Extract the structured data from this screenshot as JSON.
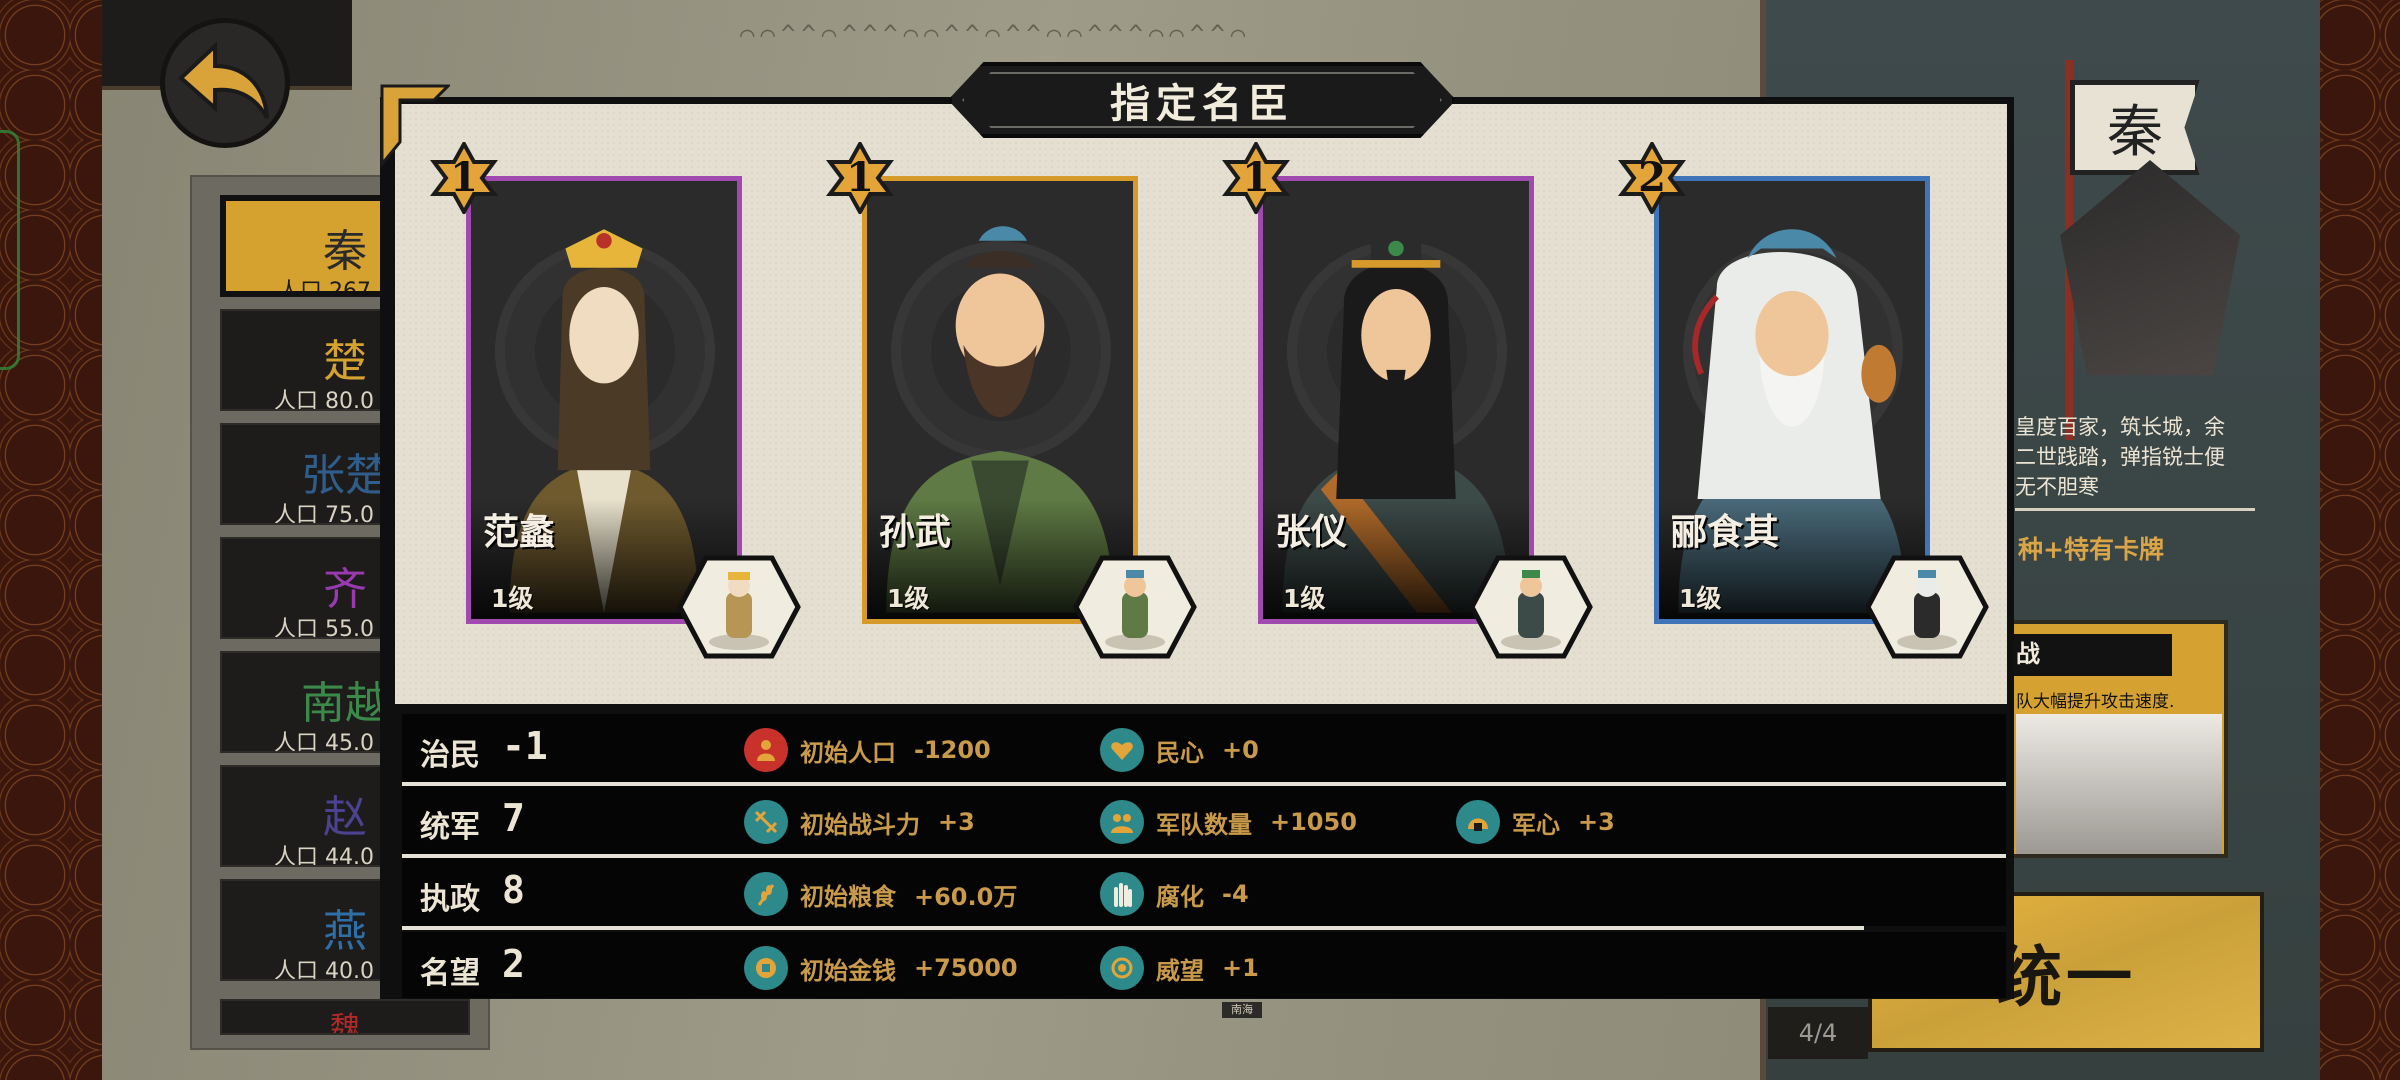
{
  "modal": {
    "title": "指定名臣"
  },
  "generals": [
    {
      "rank": "1",
      "name": "范蠡",
      "level": "1级",
      "frame_color": "#a04ab0"
    },
    {
      "rank": "1",
      "name": "孙武",
      "level": "1级",
      "frame_color": "#d69a2a"
    },
    {
      "rank": "1",
      "name": "张仪",
      "level": "1级",
      "frame_color": "#a04ab0"
    },
    {
      "rank": "2",
      "name": "郦食其",
      "level": "1级",
      "frame_color": "#3f74b8"
    }
  ],
  "stats": [
    {
      "name": "治民",
      "value": "-1",
      "effects": [
        {
          "label": "初始人口",
          "value": "-1200",
          "icon": "population-icon"
        },
        {
          "label": "民心",
          "value": "+0",
          "icon": "heart-icon"
        }
      ]
    },
    {
      "name": "统军",
      "value": "7",
      "effects": [
        {
          "label": "初始战斗力",
          "value": "+3",
          "icon": "crossbow-icon"
        },
        {
          "label": "军队数量",
          "value": "+1050",
          "icon": "troops-icon"
        },
        {
          "label": "军心",
          "value": "+3",
          "icon": "helmet-icon"
        }
      ]
    },
    {
      "name": "执政",
      "value": "8",
      "effects": [
        {
          "label": "初始粮食",
          "value": "+60.0万",
          "icon": "grain-icon"
        },
        {
          "label": "腐化",
          "value": "-4",
          "icon": "grab-hand-icon"
        }
      ]
    },
    {
      "name": "名望",
      "value": "2",
      "effects": [
        {
          "label": "初始金钱",
          "value": "+75000",
          "icon": "coin-icon"
        },
        {
          "label": "威望",
          "value": "+1",
          "icon": "prestige-icon"
        }
      ]
    }
  ],
  "factions": [
    {
      "name": "秦",
      "pop": "人口 267",
      "color": "#2a2a2a"
    },
    {
      "name": "楚",
      "pop": "人口 80.0",
      "color": "#d6a22f"
    },
    {
      "name": "张楚",
      "pop": "人口 75.0",
      "color": "#2f5e8c"
    },
    {
      "name": "齐",
      "pop": "人口 55.0",
      "color": "#9a3ab0"
    },
    {
      "name": "南越",
      "pop": "人口 45.0",
      "color": "#3c8a4a"
    },
    {
      "name": "赵",
      "pop": "人口 44.0",
      "color": "#4b4290"
    },
    {
      "name": "燕",
      "pop": "人口 40.0",
      "color": "#2f6fa8"
    },
    {
      "name": "魏",
      "pop": "",
      "color": "#b02a2a"
    }
  ],
  "right_panel": {
    "flag_char": "秦",
    "description_lines": [
      "皇度百家，筑长城，余",
      "二世践踏，弹指锐士便",
      "无不胆寒"
    ],
    "special": "种+特有卡牌",
    "card_title": "战",
    "card_text": "队大幅提升攻击速度."
  },
  "unify_button": {
    "label": "统一"
  },
  "page_counter": "4/4",
  "map_label": "南海"
}
